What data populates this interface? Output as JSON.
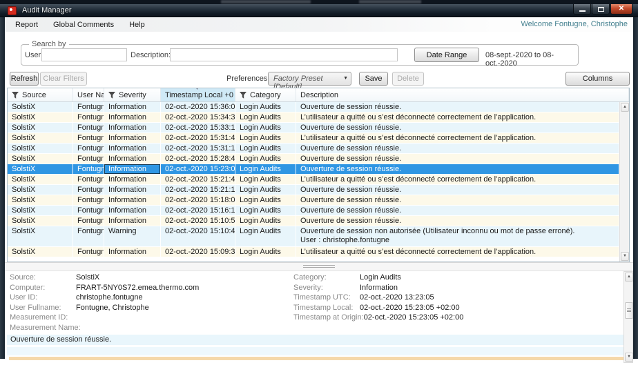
{
  "window": {
    "title": "Audit Manager",
    "welcome": "Welcome Fontugne, Christophe"
  },
  "menu": {
    "items": [
      "Report",
      "Global Comments",
      "Help"
    ]
  },
  "search": {
    "legend": "Search by",
    "user_label": "User:",
    "user_value": "",
    "description_label": "Description:",
    "description_value": "",
    "date_range_button": "Date Range",
    "date_range_value": "08-sept.-2020  to  08-oct.-2020"
  },
  "toolbar": {
    "refresh": "Refresh",
    "clear_filters": "Clear Filters",
    "preferences_label": "Preferences:",
    "preferences_value": "Factory Preset [Default]",
    "save": "Save",
    "delete": "Delete",
    "columns": "Columns"
  },
  "icons": {
    "app": "red-pinwheel",
    "minimize": "bar",
    "maximize": "box",
    "close": "✕",
    "filter": "funnel",
    "sort_desc": "▼",
    "combo_arrow": "▼",
    "scroll_up": "▲",
    "scroll_down": "▼"
  },
  "colors": {
    "selection_blue": "#2f96e3",
    "row_blue": "#e8f5fb",
    "row_cream": "#fdf9e9",
    "timestamp_header": "#cfe9f6",
    "accent_orange": "#f5d8aa",
    "welcome_text": "#44808f",
    "close_button_red": "#c34a2b"
  },
  "table": {
    "columns": [
      {
        "key": "source",
        "label": "Source",
        "filter": true
      },
      {
        "key": "user-name",
        "label": "User Na",
        "filter": false
      },
      {
        "key": "severity",
        "label": "Severity",
        "filter": true
      },
      {
        "key": "timestamp-local",
        "label": "Timestamp Local +0",
        "filter": false,
        "sort": true,
        "highlight": true
      },
      {
        "key": "category",
        "label": "Category",
        "filter": true
      },
      {
        "key": "description",
        "label": "Description",
        "filter": false
      }
    ],
    "rows": [
      {
        "source": "SolstiX",
        "user": "Fontugn",
        "severity": "Information",
        "timestamp": "02-oct.-2020 15:36:0",
        "category": "Login Audits",
        "description": "Ouverture de session réussie."
      },
      {
        "source": "SolstiX",
        "user": "Fontugn",
        "severity": "Information",
        "timestamp": "02-oct.-2020 15:34:3",
        "category": "Login Audits",
        "description": "L’utilisateur a quitté ou s’est déconnecté correctement de l’application."
      },
      {
        "source": "SolstiX",
        "user": "Fontugn",
        "severity": "Information",
        "timestamp": "02-oct.-2020 15:33:1",
        "category": "Login Audits",
        "description": "Ouverture de session réussie."
      },
      {
        "source": "SolstiX",
        "user": "Fontugn",
        "severity": "Information",
        "timestamp": "02-oct.-2020 15:31:4",
        "category": "Login Audits",
        "description": "L’utilisateur a quitté ou s’est déconnecté correctement de l’application."
      },
      {
        "source": "SolstiX",
        "user": "Fontugn",
        "severity": "Information",
        "timestamp": "02-oct.-2020 15:31:1",
        "category": "Login Audits",
        "description": "Ouverture de session réussie."
      },
      {
        "source": "SolstiX",
        "user": "Fontugn",
        "severity": "Information",
        "timestamp": "02-oct.-2020 15:28:4",
        "category": "Login Audits",
        "description": "Ouverture de session réussie."
      },
      {
        "source": "SolstiX",
        "user": "Fontugn",
        "severity": "Information",
        "timestamp": "02-oct.-2020 15:23:0",
        "category": "Login Audits",
        "description": "Ouverture de session réussie.",
        "selected": true
      },
      {
        "source": "SolstiX",
        "user": "Fontugn",
        "severity": "Information",
        "timestamp": "02-oct.-2020 15:21:4",
        "category": "Login Audits",
        "description": "L’utilisateur a quitté ou s’est déconnecté correctement de l’application."
      },
      {
        "source": "SolstiX",
        "user": "Fontugn",
        "severity": "Information",
        "timestamp": "02-oct.-2020 15:21:1",
        "category": "Login Audits",
        "description": "Ouverture de session réussie."
      },
      {
        "source": "SolstiX",
        "user": "Fontugn",
        "severity": "Information",
        "timestamp": "02-oct.-2020 15:18:0",
        "category": "Login Audits",
        "description": "Ouverture de session réussie."
      },
      {
        "source": "SolstiX",
        "user": "Fontugn",
        "severity": "Information",
        "timestamp": "02-oct.-2020 15:16:1",
        "category": "Login Audits",
        "description": "Ouverture de session réussie."
      },
      {
        "source": "SolstiX",
        "user": "Fontugn",
        "severity": "Information",
        "timestamp": "02-oct.-2020 15:10:5",
        "category": "Login Audits",
        "description": "Ouverture de session réussie."
      },
      {
        "source": "SolstiX",
        "user": "Fontugn",
        "severity": "Warning",
        "timestamp": "02-oct.-2020 15:10:4",
        "category": "Login Audits",
        "description": "Ouverture de session non autorisée (Utilisateur inconnu ou mot de passe erroné).",
        "description2": "User : christophe.fontugne"
      },
      {
        "source": "SolstiX",
        "user": "Fontugn",
        "severity": "Information",
        "timestamp": "02-oct.-2020 15:09:3",
        "category": "Login Audits",
        "description": "L’utilisateur a quitté ou s’est déconnecté correctement de l’application."
      }
    ]
  },
  "details": {
    "left": [
      {
        "label": "Source:",
        "value": "SolstiX"
      },
      {
        "label": "Computer:",
        "value": "FRART-5NY0S72.emea.thermo.com"
      },
      {
        "label": "User ID:",
        "value": "christophe.fontugne"
      },
      {
        "label": "User Fullname:",
        "value": "Fontugne, Christophe"
      },
      {
        "label": "Measurement ID:",
        "value": ""
      },
      {
        "label": "Measurement Name:",
        "value": ""
      }
    ],
    "right": [
      {
        "label": "Category:",
        "value": "Login Audits"
      },
      {
        "label": "Severity:",
        "value": "Information"
      },
      {
        "label": "Timestamp UTC:",
        "value": "02-oct.-2020 13:23:05"
      },
      {
        "label": "Timestamp Local:",
        "value": "02-oct.-2020 15:23:05 +02:00"
      },
      {
        "label": "Timestamp at Origin:",
        "value": "02-oct.-2020 15:23:05 +02:00"
      }
    ]
  },
  "message_rows": [
    "Ouverture de session réussie.",
    ""
  ]
}
